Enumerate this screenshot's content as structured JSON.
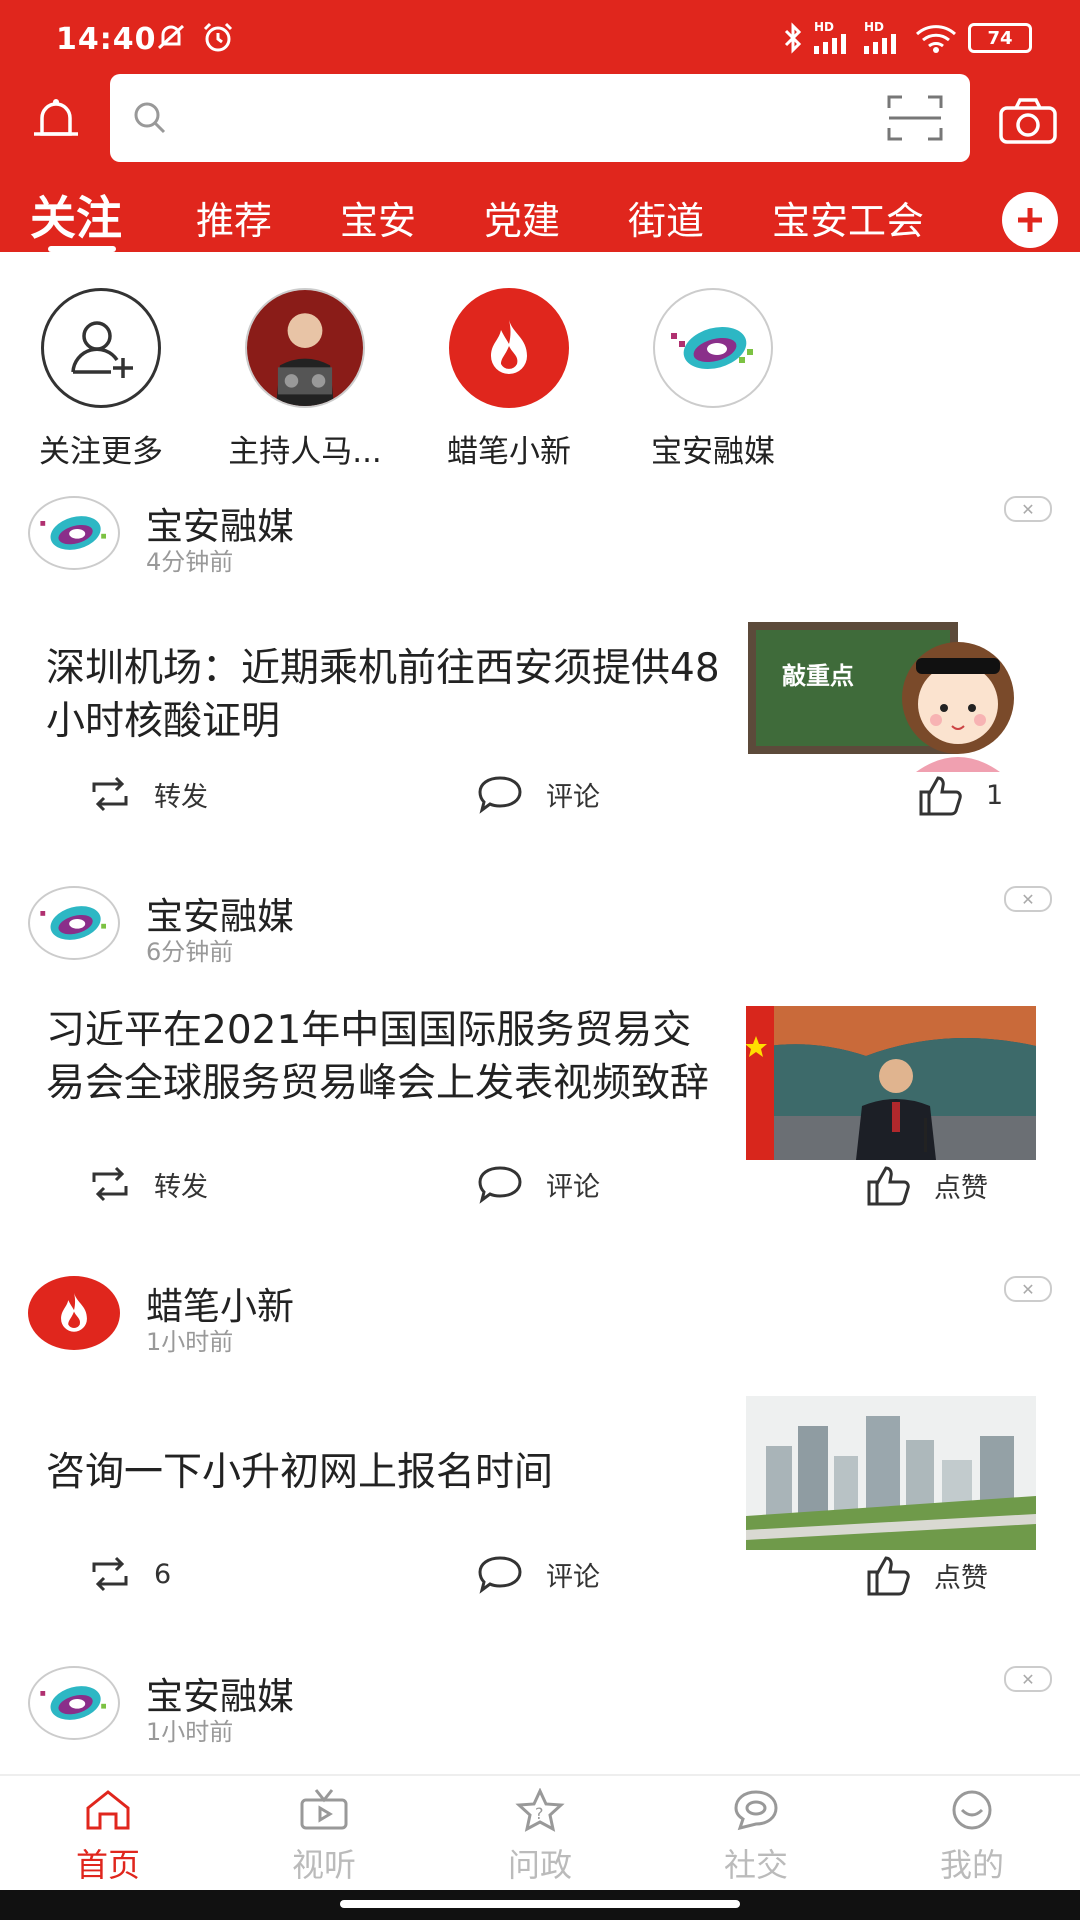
{
  "status_bar": {
    "time": "14:40",
    "battery": "74",
    "hd1": "HD",
    "hd2": "HD"
  },
  "header": {
    "search_placeholder": ""
  },
  "tabs": [
    {
      "label": "关注",
      "active": true
    },
    {
      "label": "推荐"
    },
    {
      "label": "宝安"
    },
    {
      "label": "党建"
    },
    {
      "label": "街道"
    },
    {
      "label": "宝安工会"
    }
  ],
  "follow_strip": [
    {
      "label": "关注更多"
    },
    {
      "label": "主持人马..."
    },
    {
      "label": "蜡笔小新"
    },
    {
      "label": "宝安融媒"
    }
  ],
  "feed": [
    {
      "source": "宝安融媒",
      "time_ago": "4分钟前",
      "title": "深圳机场：近期乘机前往西安须提供48小时核酸证明",
      "thumb_caption": "敲重点",
      "repost": "转发",
      "comment": "评论",
      "like": "1"
    },
    {
      "source": "宝安融媒",
      "time_ago": "6分钟前",
      "title": "习近平在2021年中国国际服务贸易交易会全球服务贸易峰会上发表视频致辞",
      "repost": "转发",
      "comment": "评论",
      "like": "点赞"
    },
    {
      "source": "蜡笔小新",
      "time_ago": "1小时前",
      "title": "咨询一下小升初网上报名时间",
      "repost": "6",
      "comment": "评论",
      "like": "点赞"
    },
    {
      "source": "宝安融媒",
      "time_ago": "1小时前"
    }
  ],
  "bottom_nav": [
    {
      "label": "首页",
      "icon": "home-icon",
      "active": true
    },
    {
      "label": "视听",
      "icon": "tv-icon"
    },
    {
      "label": "问政",
      "icon": "question-star-icon"
    },
    {
      "label": "社交",
      "icon": "chat-icon"
    },
    {
      "label": "我的",
      "icon": "smile-icon"
    }
  ],
  "colors": {
    "brand_red": "#e0261d",
    "inactive_gray": "#bbbbbb"
  }
}
